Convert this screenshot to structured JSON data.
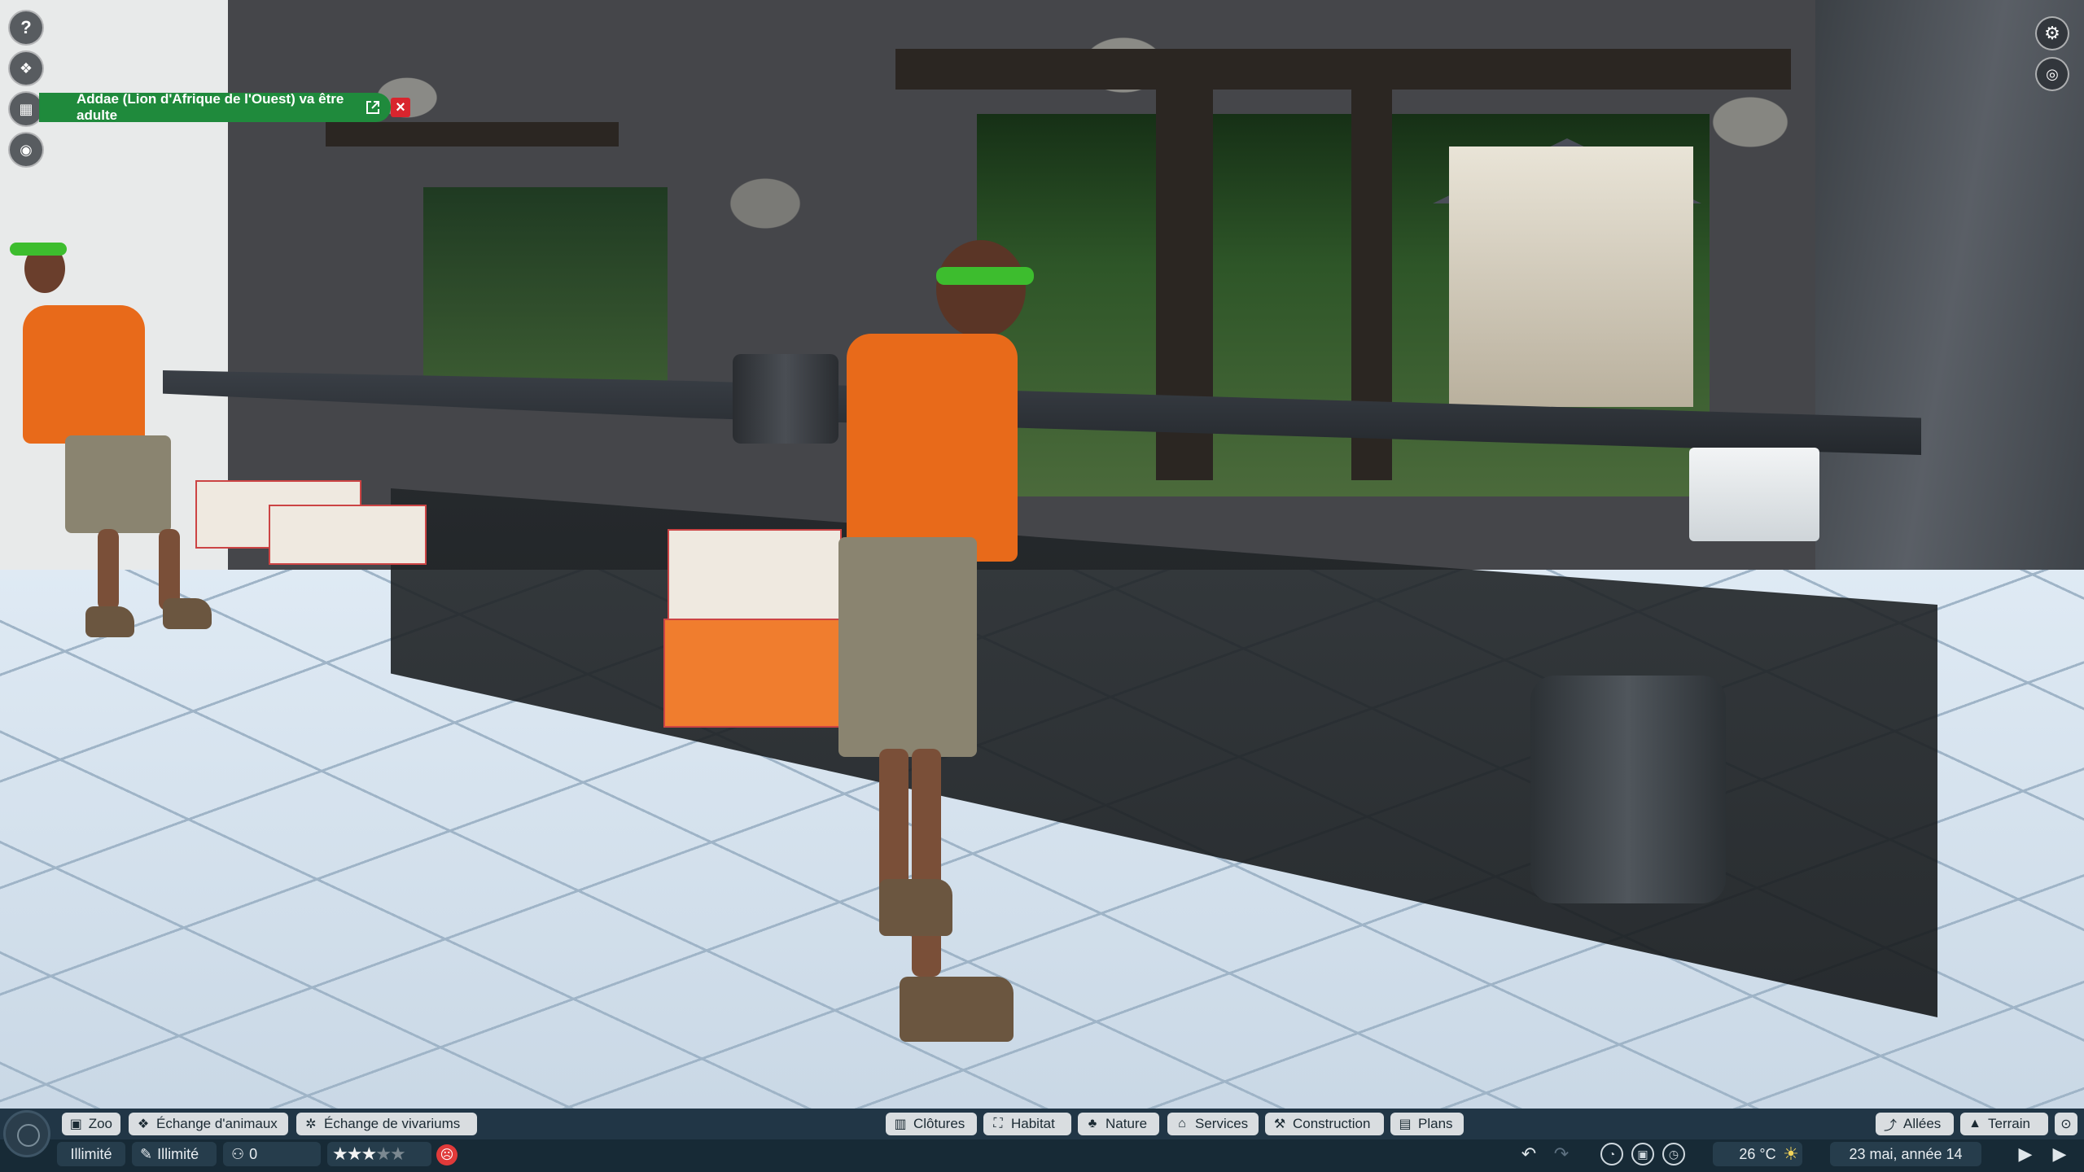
{
  "notification": {
    "text": "Addae (Lion d'Afrique de l'Ouest) va être adulte",
    "accent": "#1f8a3c",
    "close_color": "#d9252e"
  },
  "left_icons": [
    "help-icon",
    "animal-paw-icon",
    "calendar-icon",
    "camera-view-icon"
  ],
  "right_icons": [
    "settings-gear-icon",
    "toggle-view-icon"
  ],
  "menu_left": {
    "zoo": "Zoo",
    "animal_trade": "Échange d'animaux",
    "vivarium_trade": "Échange de vivariums"
  },
  "menu_center": {
    "fences": "Clôtures",
    "habitat": "Habitat",
    "nature": "Nature",
    "services": "Services",
    "construction": "Construction",
    "plans": "Plans"
  },
  "menu_right": {
    "paths": "Allées",
    "terrain": "Terrain"
  },
  "status": {
    "money": "Illimité",
    "research": "Illimité",
    "guests": "0",
    "rating_stars": 3,
    "rating_max": 5,
    "temperature": "26 °C",
    "date": "23 mai, année 14"
  },
  "colors": {
    "bar_bg": "#1c2f3c",
    "button_bg": "#d9dde0",
    "staff_shirt": "#e86a1a",
    "staff_visor": "#3dbd2e"
  }
}
